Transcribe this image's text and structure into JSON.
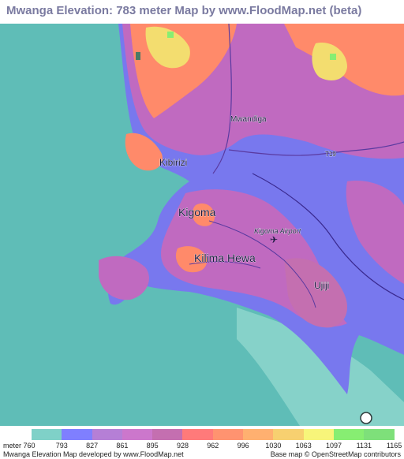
{
  "title": "Mwanga Elevation: 783 meter Map by www.FloodMap.net (beta)",
  "places": {
    "mwandiga": "Mwandiga",
    "kibirizi": "Kibirizi",
    "kigoma": "Kigoma",
    "kigoma_airport": "Kigoma Airport",
    "kilima_hewa": "Kilima Hewa",
    "ujiji": "Ujiji",
    "road_t19": "T19"
  },
  "legend": {
    "unit": "meter",
    "first_value": "760",
    "values": [
      "793",
      "827",
      "861",
      "895",
      "928",
      "962",
      "996",
      "1030",
      "1063",
      "1097",
      "1131",
      "1165"
    ],
    "colors": [
      "#7fd1c8",
      "#7f7fff",
      "#b57fd6",
      "#cc77cc",
      "#c46fb0",
      "#ff7a7a",
      "#ff9370",
      "#ffb070",
      "#f7d070",
      "#f7f57a",
      "#87ee72",
      "#7ee07a"
    ]
  },
  "colors": {
    "lake": "#5fbdb7",
    "lowland": "#7878ee",
    "mid": "#c06ac0",
    "high": "#ff8a6a",
    "peak": "#f3dd6f"
  },
  "footer": {
    "left": "Mwanga Elevation Map developed by www.FloodMap.net",
    "right": "Base map © OpenStreetMap contributors"
  }
}
